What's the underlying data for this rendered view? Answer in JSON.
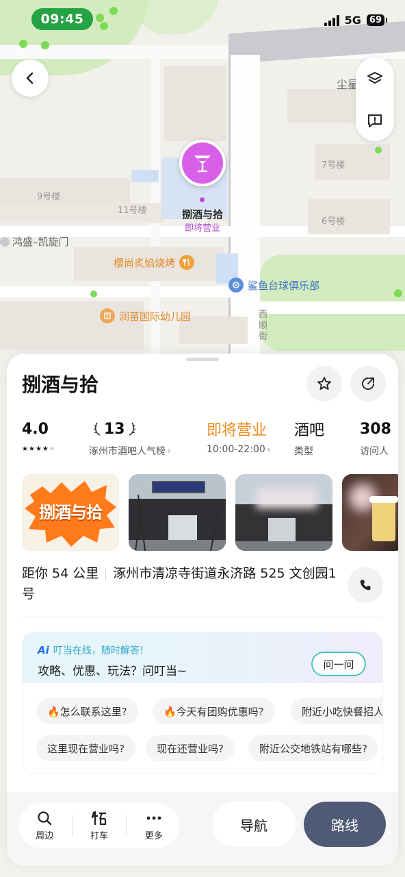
{
  "status_bar": {
    "time": "09:45",
    "network": "5G",
    "battery": "69"
  },
  "map": {
    "labels": {
      "dust_star": "尘星",
      "bldg_9": "9号楼",
      "bldg_11": "11号楼",
      "bldg_7": "7号楼",
      "bldg_6": "6号楼",
      "hongsheng": "鸿盛–凯旋门",
      "bbq": "樱尚炙焰烧烤",
      "billiards": "鲨鱼台球俱乐部",
      "kindergarten": "润苗国际幼儿园",
      "street": "西顺街"
    },
    "pin": {
      "name": "捌酒与拾",
      "status": "即将营业",
      "color": "#d860e8"
    }
  },
  "place": {
    "name": "捌酒与拾",
    "rating": "4.0",
    "stars_filled": 4,
    "stars_total": 5,
    "rank_number": "13",
    "rank_label": "涿州市酒吧人气榜",
    "open_status": "即将营业",
    "hours": "10:00-22:00",
    "category": "酒吧",
    "category_label": "类型",
    "visitors": "308",
    "visitors_label": "访问人",
    "photos": [
      {
        "kind": "logo",
        "text": "捌酒与拾"
      },
      {
        "kind": "storefront-photo",
        "sign": "捌酒与拾"
      },
      {
        "kind": "storefront-photo"
      },
      {
        "kind": "drink-photo"
      }
    ],
    "distance": "距你 54 公里",
    "address": "涿州市清凉寺街道永济路 525 文创园1号"
  },
  "ai": {
    "logo": "Ai",
    "hint": "叮当在线，随时解答！",
    "question": "攻略、优惠、玩法？问叮当~",
    "ask_button": "问一问",
    "chips_row1": [
      "🔥怎么联系这里?",
      "🔥今天有团购优惠吗?",
      "附近小吃快餐招人"
    ],
    "chips_row2": [
      "这里现在营业吗?",
      "现在还营业吗?",
      "附近公交地铁站有哪些?"
    ]
  },
  "bottom": {
    "nearby": "周边",
    "taxi": "打车",
    "more": "更多",
    "navigate": "导航",
    "route": "路线"
  },
  "colors": {
    "accent_orange": "#ef8a1b",
    "route_button": "#4f5a75",
    "pin_purple": "#d860e8",
    "ai_border": "#4ac6b9"
  }
}
